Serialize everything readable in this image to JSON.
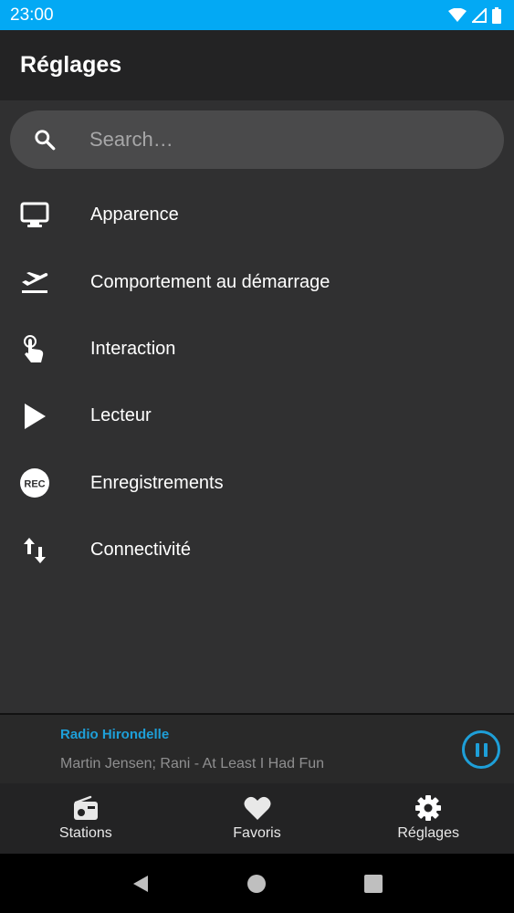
{
  "status_bar": {
    "time": "23:00"
  },
  "app_bar": {
    "title": "Réglages"
  },
  "search": {
    "placeholder": "Search…"
  },
  "menu": {
    "items": [
      {
        "label": "Apparence",
        "icon": "monitor-icon"
      },
      {
        "label": "Comportement au démarrage",
        "icon": "flight-takeoff-icon"
      },
      {
        "label": "Interaction",
        "icon": "touch-app-icon"
      },
      {
        "label": "Lecteur",
        "icon": "play-icon"
      },
      {
        "label": "Enregistrements",
        "icon": "record-icon",
        "badge": "REC"
      },
      {
        "label": "Connectivité",
        "icon": "swap-vertical-icon"
      }
    ]
  },
  "player": {
    "station": "Radio Hirondelle",
    "track": "Martin Jensen; Rani - At Least I Had Fun",
    "state_icon": "pause-icon"
  },
  "bottom_nav": {
    "items": [
      {
        "label": "Stations",
        "icon": "radio-icon"
      },
      {
        "label": "Favoris",
        "icon": "heart-icon"
      },
      {
        "label": "Réglages",
        "icon": "gear-icon"
      }
    ]
  },
  "colors": {
    "status_bar": "#03a9f4",
    "accent": "#1e9fd8",
    "background": "#303031",
    "app_bar": "#232324"
  }
}
